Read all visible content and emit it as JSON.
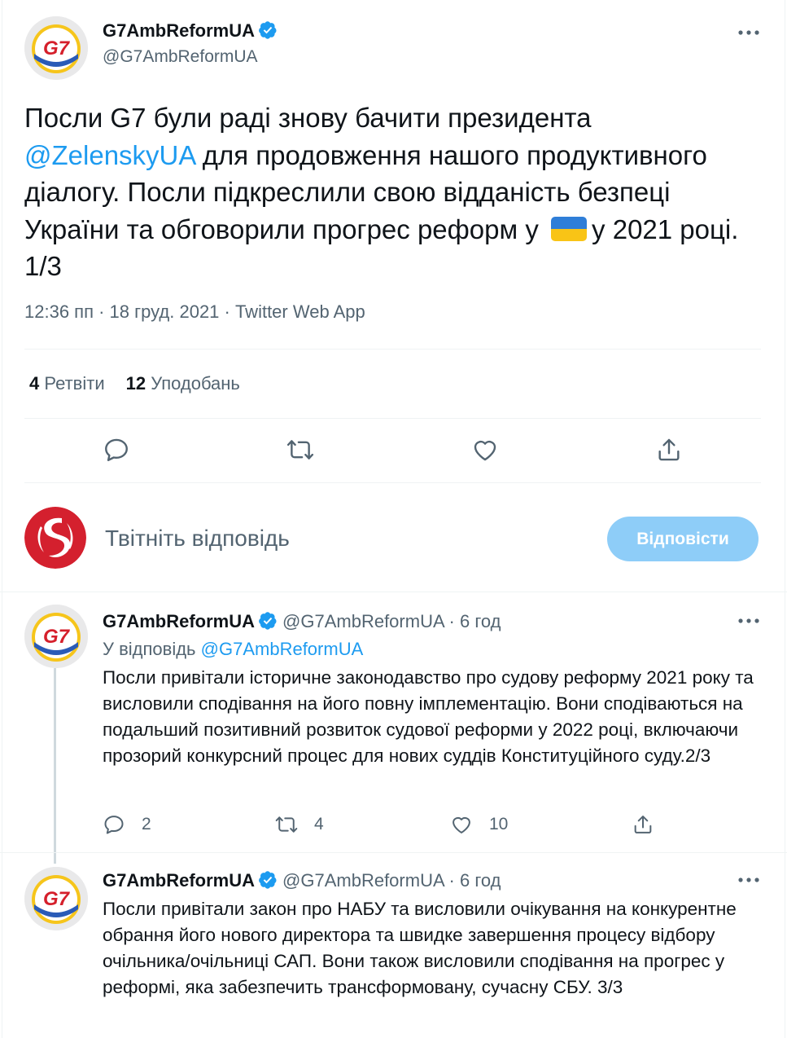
{
  "main_tweet": {
    "author_name": "G7AmbReformUA",
    "author_handle": "@G7AmbReformUA",
    "avatar_label": "G7",
    "text_part1": "Посли G7 були раді знову бачити президента",
    "mention": "@ZelenskyUA",
    "text_part2": " для продовження нашого продуктивного діалогу. Посли підкреслили свою відданість безпеці України та обговорили прогрес реформ у",
    "text_part3": "у 2021 році. 1/3",
    "meta": "12:36 пп · 18 груд. 2021 · Twitter Web App",
    "retweets_count": "4",
    "retweets_label": "Ретвіти",
    "likes_count": "12",
    "likes_label": "Уподобань"
  },
  "composer": {
    "placeholder": "Твітніть відповідь",
    "reply_button": "Відповісти"
  },
  "thread": [
    {
      "author_name": "G7AmbReformUA",
      "handle_time": "@G7AmbReformUA · 6 год",
      "replying_to_prefix": "У відповідь",
      "replying_to_handle": "@G7AmbReformUA",
      "text": "Посли привітали історичне законодавство про судову реформу 2021 року та висловили сподівання на його повну імплементацію. Вони сподіваються на подальший позитивний розвиток судової реформи у 2022 році, включаючи прозорий конкурсний процес для нових суддів Конституційного суду.2/3",
      "reply_count": "2",
      "retweet_count": "4",
      "like_count": "10"
    },
    {
      "author_name": "G7AmbReformUA",
      "handle_time": "@G7AmbReformUA · 6 год",
      "text": "Посли привітали закон про НАБУ та висловили очікування на конкурентне обрання його нового директора та швидке завершення процесу відбору очільника/очільниці САП. Вони також висловили сподівання на прогрес у реформі, яка забезпечить трансформовану, сучасну СБУ. 3/3"
    }
  ],
  "colors": {
    "accent": "#1d9bf0",
    "secondary_text": "#536471",
    "reply_button_disabled": "#8ecdf8",
    "flag_blue": "#2f7ed8",
    "flag_yellow": "#f9c416"
  },
  "icons": [
    "verified-badge-icon",
    "more-options-icon",
    "reply-icon",
    "retweet-icon",
    "like-icon",
    "share-icon",
    "ukraine-flag-emoji"
  ]
}
